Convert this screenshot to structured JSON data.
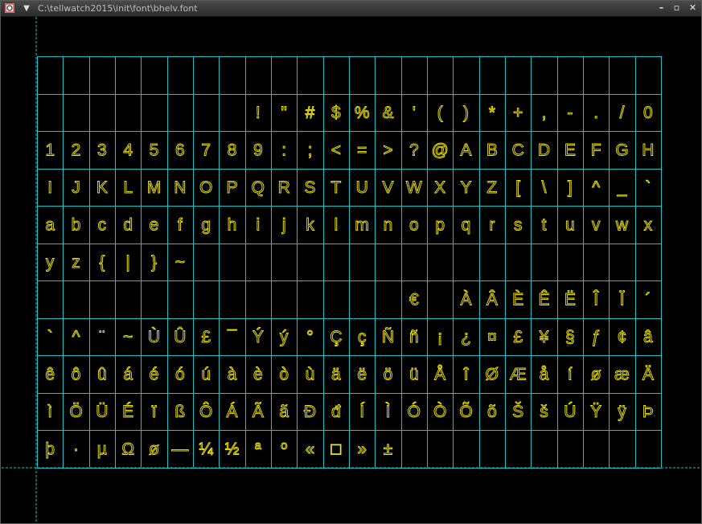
{
  "window": {
    "title": "C:\\tellwatch2015\\init\\font\\bhelv.font",
    "menu_glyph": "▼",
    "controls": {
      "minimize": "–",
      "maximize": "▫",
      "close": "✕"
    }
  },
  "colors": {
    "background": "#000000",
    "grid": "#19c3c3",
    "glyph": "#f2e600"
  },
  "font_grid": {
    "columns": 24,
    "rows": [
      [
        "",
        "",
        "",
        "",
        "",
        "",
        "",
        "",
        "",
        "",
        "",
        "",
        "",
        "",
        "",
        "",
        "",
        "",
        "",
        "",
        "",
        "",
        "",
        ""
      ],
      [
        "",
        "",
        "",
        "",
        "",
        "",
        "",
        "",
        "!",
        "\"",
        "#",
        "$",
        "%",
        "&",
        "'",
        "(",
        ")",
        "*",
        "+",
        ",",
        "-",
        ".",
        "/",
        "0"
      ],
      [
        "1",
        "2",
        "3",
        "4",
        "5",
        "6",
        "7",
        "8",
        "9",
        ":",
        ";",
        "<",
        "=",
        ">",
        "?",
        "@",
        "A",
        "B",
        "C",
        "D",
        "E",
        "F",
        "G",
        "H"
      ],
      [
        "I",
        "J",
        "K",
        "L",
        "M",
        "N",
        "O",
        "P",
        "Q",
        "R",
        "S",
        "T",
        "U",
        "V",
        "W",
        "X",
        "Y",
        "Z",
        "[",
        "\\",
        "]",
        "^",
        "_",
        "`"
      ],
      [
        "a",
        "b",
        "c",
        "d",
        "e",
        "f",
        "g",
        "h",
        "i",
        "j",
        "k",
        "l",
        "m",
        "n",
        "o",
        "p",
        "q",
        "r",
        "s",
        "t",
        "u",
        "v",
        "w",
        "x"
      ],
      [
        "y",
        "z",
        "{",
        "|",
        "}",
        "~",
        "",
        "",
        "",
        "",
        "",
        "",
        "",
        "",
        "",
        "",
        "",
        "",
        "",
        "",
        "",
        "",
        "",
        ""
      ],
      [
        "",
        "",
        "",
        "",
        "",
        "",
        "",
        "",
        "",
        "",
        "",
        "",
        "",
        "",
        "€",
        "",
        "À",
        "Â",
        "È",
        "Ê",
        "Ë",
        "Î",
        "Ï",
        "´"
      ],
      [
        "`",
        "^",
        "¨",
        "~",
        "Ù",
        "Û",
        "£",
        "¯",
        "Ý",
        "ý",
        "°",
        "Ç",
        "ç",
        "Ñ",
        "ñ",
        "¡",
        "¿",
        "¤",
        "£",
        "¥",
        "§",
        "ƒ",
        "¢",
        "â"
      ],
      [
        "ê",
        "ô",
        "û",
        "á",
        "é",
        "ó",
        "ú",
        "à",
        "è",
        "ò",
        "ù",
        "ä",
        "ë",
        "ö",
        "ü",
        "Å",
        "î",
        "Ø",
        "Æ",
        "å",
        "í",
        "ø",
        "æ",
        "Ä"
      ],
      [
        "ì",
        "Ö",
        "Ü",
        "É",
        "ï",
        "ß",
        "Ô",
        "Á",
        "Ã",
        "ã",
        "Đ",
        "đ",
        "Í",
        "Ì",
        "Ó",
        "Ò",
        "Õ",
        "õ",
        "Š",
        "š",
        "Ú",
        "Ÿ",
        "ÿ",
        "Þ"
      ],
      [
        "þ",
        "·",
        "µ",
        "Ω",
        "ø",
        "—",
        "¼",
        "½",
        "ª",
        "º",
        "«",
        "□",
        "»",
        "±",
        "",
        "",
        "",
        "",
        "",
        "",
        "",
        "",
        "",
        ""
      ]
    ]
  }
}
